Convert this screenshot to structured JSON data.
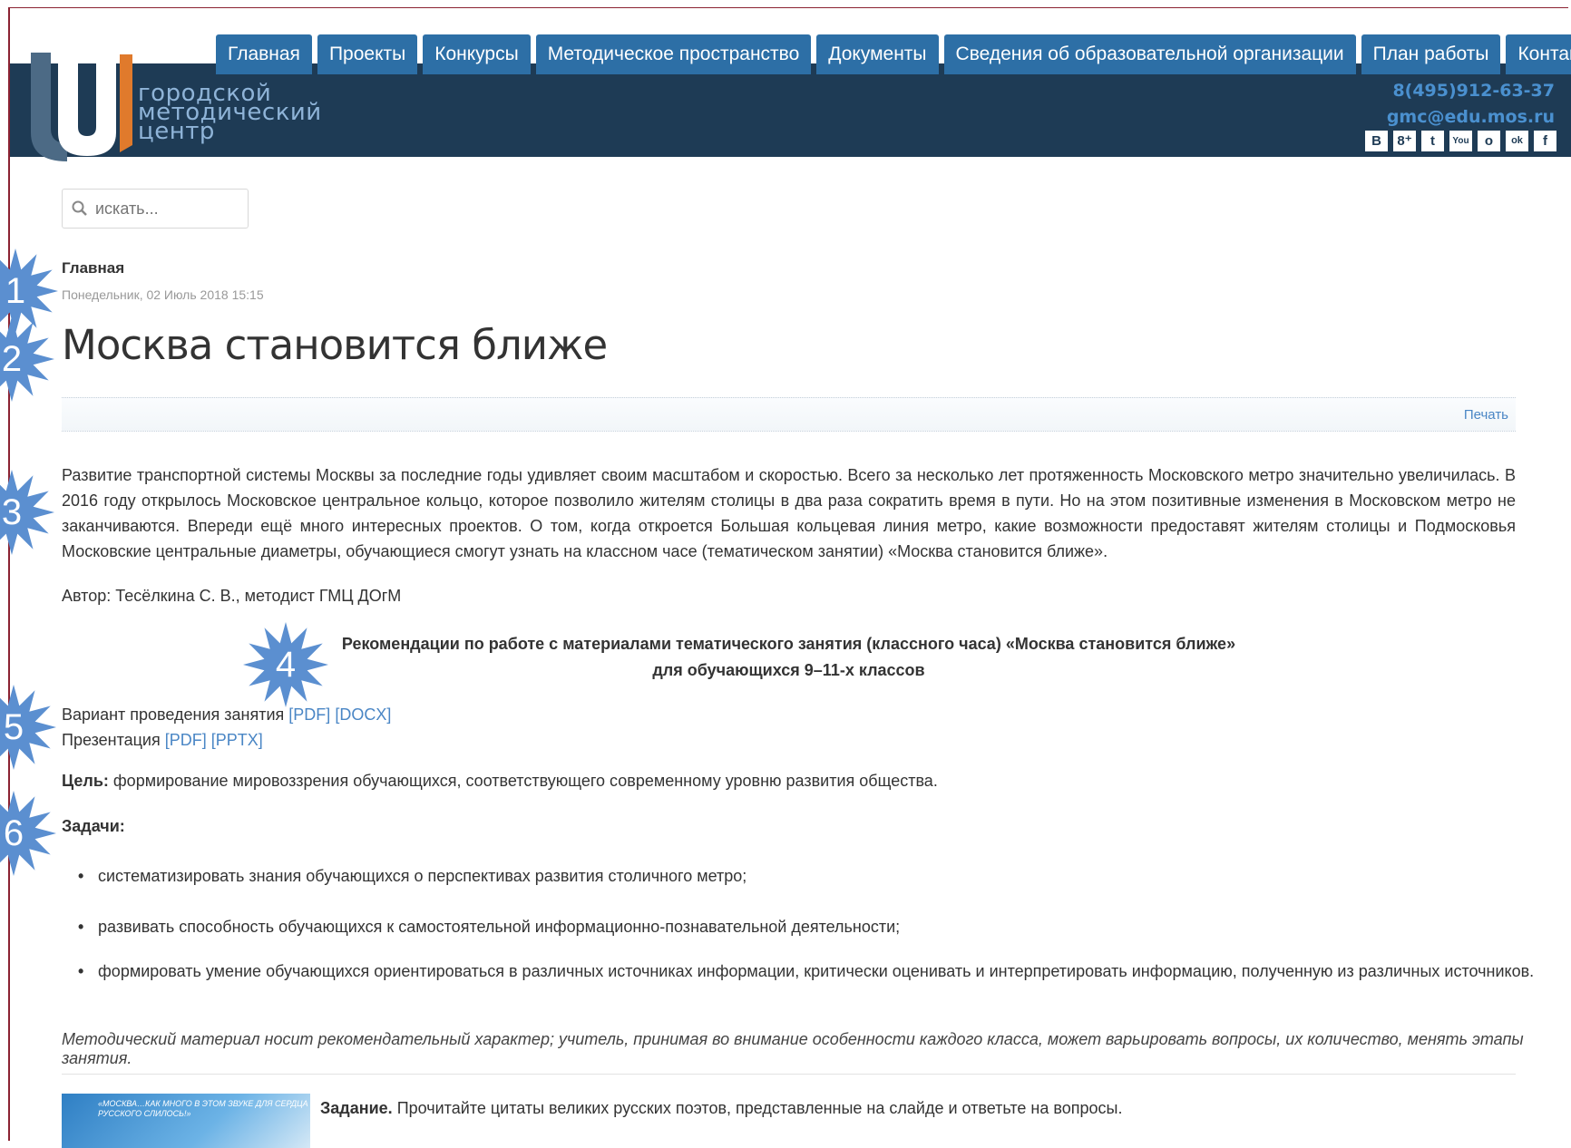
{
  "nav": [
    "Главная",
    "Проекты",
    "Конкурсы",
    "Методическое пространство",
    "Документы",
    "Сведения об образовательной организации",
    "План работы",
    "Контакты"
  ],
  "logo": {
    "line1": "городской",
    "line2": "методический",
    "line3": "центр"
  },
  "contacts": {
    "phone": "8(495)912-63-37",
    "email": "gmc@edu.mos.ru"
  },
  "social": [
    "В",
    "8⁺",
    "t",
    "You",
    "o",
    "ok",
    "f"
  ],
  "social_icons": [
    "vk-icon",
    "google-plus-icon",
    "twitter-icon",
    "youtube-icon",
    "livejournal-icon",
    "odnoklassniki-icon",
    "facebook-icon"
  ],
  "search": {
    "placeholder": "искать..."
  },
  "breadcrumb": "Главная",
  "date": "Понедельник, 02 Июль 2018 15:15",
  "title": "Москва становится ближе",
  "print": "Печать",
  "intro": "Развитие транспортной системы Москвы за последние годы удивляет своим масштабом и скоростью. Всего за несколько лет протяженность Московского метро значительно увеличилась. В 2016 году открылось Московское центральное кольцо, которое позволило жителям столицы в два раза сократить время в пути. Но на этом позитивные изменения в Московском метро не заканчиваются. Впереди ещё много интересных проектов. О том, когда откроется Большая кольцевая линия метро, какие возможности предоставят жителям столицы и Подмосковья Московские центральные диаметры, обучающиеся смогут узнать на классном часе (тематическом занятии) «Москва становится ближе».",
  "author": "Автор: Тесёлкина С. В., методист ГМЦ ДОгМ",
  "rec": {
    "line1": "Рекомендации по работе с материалами тематического занятия (классного часа) «Москва становится ближе»",
    "line2": "для обучающихся 9–11-х классов"
  },
  "variant": {
    "label": "Вариант проведения занятия ",
    "pdf": "[PDF]",
    "docx": "[DOCX]"
  },
  "presentation": {
    "label": "Презентация ",
    "pdf": "[PDF]",
    "pptx": "[PPTX]"
  },
  "goal": {
    "label": "Цель:",
    "text": " формирование мировоззрения обучающихся, соответствующего современному уровню развития общества."
  },
  "tasks_heading": "Задачи:",
  "tasks": [
    "систематизировать знания обучающихся о перспективах развития столичного метро;",
    "развивать способность обучающихся к самостоятельной информационно-познавательной деятельности;",
    "формировать умение обучающихся ориентироваться в различных источниках информации, критически оценивать и интерпретировать информацию, полученную из различных источников."
  ],
  "note": "Методический материал носит рекомендательный характер; учитель, принимая во внимание особенности каждого класса, может варьировать вопросы, их количество, менять этапы занятия.",
  "thumb_caption": "«МОСКВА…КАК МНОГО В ЭТОМ ЗВУКЕ ДЛЯ СЕРДЦА РУССКОГО СЛИЛОСЬ!»",
  "task": {
    "label": "Задание.",
    "text": " Прочитайте цитаты великих русских поэтов, представленные на слайде и ответьте на вопросы."
  },
  "markers": [
    "1",
    "2",
    "3",
    "4",
    "5",
    "6"
  ],
  "colors": {
    "header": "#1e3b55",
    "tab": "#2d6fa6",
    "link": "#4a86c5",
    "marker": "#5b8fd0"
  }
}
